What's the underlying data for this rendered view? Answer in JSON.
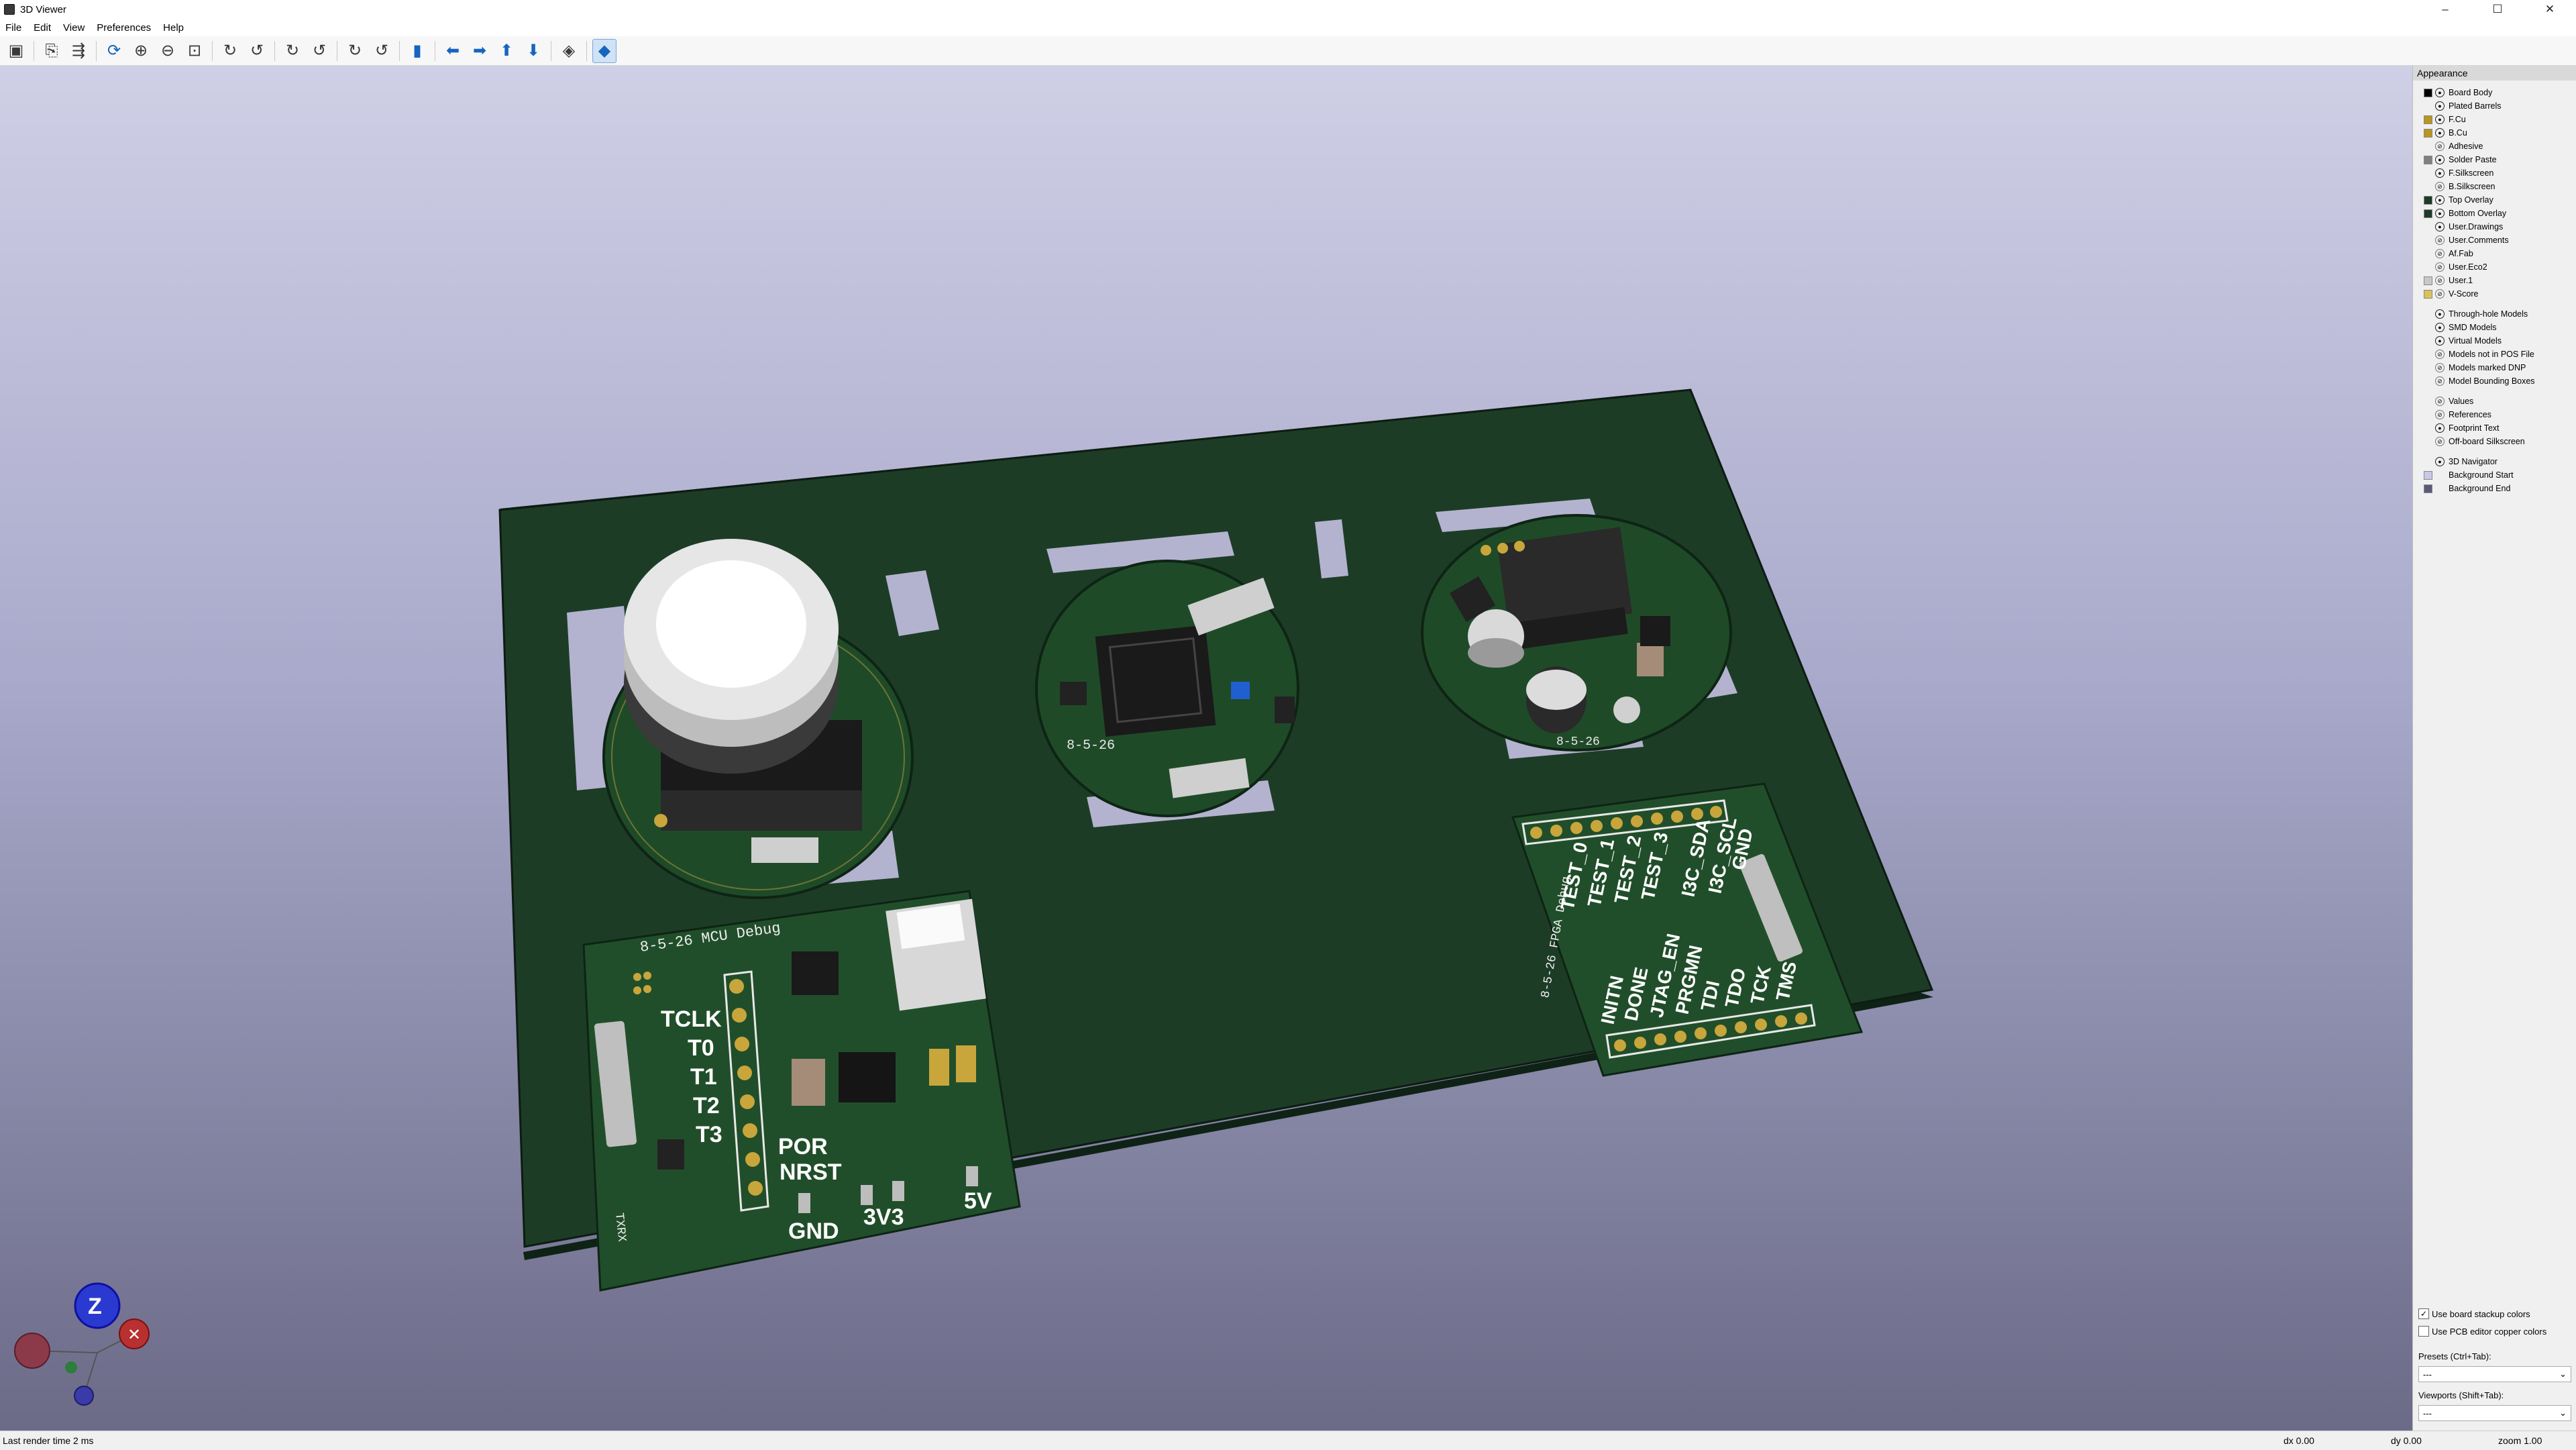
{
  "window": {
    "title": "3D Viewer",
    "controls": [
      "–",
      "☐",
      "✕"
    ]
  },
  "menu": [
    "File",
    "Edit",
    "View",
    "Preferences",
    "Help"
  ],
  "toolbar": {
    "tools": [
      {
        "name": "render-raytracing-button",
        "glyph": "▣"
      },
      {
        "name": "copy-image-button",
        "glyph": "⎘"
      },
      {
        "name": "export-image-button",
        "glyph": "⇶"
      },
      {
        "name": "reload-board-button",
        "glyph": "⟳"
      },
      {
        "name": "zoom-in-button",
        "glyph": "⊕"
      },
      {
        "name": "zoom-out-button",
        "glyph": "⊖"
      },
      {
        "name": "zoom-fit-button",
        "glyph": "⊡"
      },
      {
        "name": "rotate-x-cw-button",
        "glyph": "↻"
      },
      {
        "name": "rotate-x-ccw-button",
        "glyph": "↺"
      },
      {
        "name": "rotate-y-cw-button",
        "glyph": "↻"
      },
      {
        "name": "rotate-y-ccw-button",
        "glyph": "↺"
      },
      {
        "name": "rotate-z-cw-button",
        "glyph": "↻"
      },
      {
        "name": "rotate-z-ccw-button",
        "glyph": "↺"
      },
      {
        "name": "flip-board-button",
        "glyph": "▮"
      },
      {
        "name": "pan-left-button",
        "glyph": "⬅"
      },
      {
        "name": "pan-right-button",
        "glyph": "➡"
      },
      {
        "name": "pan-up-button",
        "glyph": "⬆"
      },
      {
        "name": "pan-down-button",
        "glyph": "⬇"
      },
      {
        "name": "toggle-orthographic-button",
        "glyph": "◈"
      },
      {
        "name": "toggle-layers-button",
        "glyph": "◆"
      }
    ]
  },
  "board": {
    "mcu_debug_title": "8-5-26 MCU Debug",
    "fpga_debug_title": "8-5-26 FPGA Debug",
    "mcu_labels": [
      "TCLK",
      "T0",
      "T1",
      "T2",
      "T3"
    ],
    "por_label": "POR",
    "nrst_label": "NRST",
    "gnd_label": "GND",
    "v33_label": "3V3",
    "v5_label": "5V",
    "txrx_label": "TXRX",
    "fpga_top_labels": [
      "TEST_0",
      "TEST_1",
      "TEST_2",
      "TEST_3",
      "I3C_SDA",
      "I3C_SCL",
      "GND"
    ],
    "fpga_bottom_labels": [
      "INITN",
      "DONE",
      "JTAG_EN",
      "PRGMN",
      "TDI",
      "TDO",
      "TCK",
      "TMS"
    ],
    "round_board_label": "8-5-26",
    "round_board_label_3": "8-5-26"
  },
  "navigator": {
    "z": "Z",
    "x_close": "✕"
  },
  "appearance": {
    "header": "Appearance",
    "layers": [
      {
        "label": "Board Body",
        "color": "#000000",
        "visible": true
      },
      {
        "label": "Plated Barrels",
        "color": "",
        "visible": true
      },
      {
        "label": "F.Cu",
        "color": "#b8961f",
        "visible": true
      },
      {
        "label": "B.Cu",
        "color": "#b8961f",
        "visible": true
      },
      {
        "label": "Adhesive",
        "color": "",
        "visible": false
      },
      {
        "label": "Solder Paste",
        "color": "#808080",
        "visible": true
      },
      {
        "label": "F.Silkscreen",
        "color": "",
        "visible": true
      },
      {
        "label": "B.Silkscreen",
        "color": "",
        "visible": false
      },
      {
        "label": "Top Overlay",
        "color": "#1e3a2a",
        "visible": true
      },
      {
        "label": "Bottom Overlay",
        "color": "#1e3a2a",
        "visible": true
      },
      {
        "label": "User.Drawings",
        "color": "",
        "visible": true
      },
      {
        "label": "User.Comments",
        "color": "",
        "visible": false
      },
      {
        "label": "Af.Fab",
        "color": "",
        "visible": false
      },
      {
        "label": "User.Eco2",
        "color": "",
        "visible": false
      },
      {
        "label": "User.1",
        "color": "#c8c8c8",
        "visible": false
      },
      {
        "label": "V-Score",
        "color": "#d8c35a",
        "visible": false
      }
    ],
    "models": [
      {
        "label": "Through-hole Models",
        "visible": true
      },
      {
        "label": "SMD Models",
        "visible": true
      },
      {
        "label": "Virtual Models",
        "visible": true
      },
      {
        "label": "Models not in POS File",
        "visible": false
      },
      {
        "label": "Models marked DNP",
        "visible": false
      },
      {
        "label": "Model Bounding Boxes",
        "visible": false
      }
    ],
    "texts": [
      {
        "label": "Values",
        "visible": false
      },
      {
        "label": "References",
        "visible": false
      },
      {
        "label": "Footprint Text",
        "visible": true
      },
      {
        "label": "Off-board Silkscreen",
        "visible": false
      }
    ],
    "misc": [
      {
        "label": "3D Navigator",
        "color": "",
        "visible": true
      },
      {
        "label": "Background Start",
        "color": "#c8c8e6",
        "visible": null
      },
      {
        "label": "Background End",
        "color": "#5a5a78",
        "visible": null
      }
    ],
    "use_stackup_colors": "Use board stackup colors",
    "use_pcb_copper_colors": "Use PCB editor copper colors",
    "presets_label": "Presets (Ctrl+Tab):",
    "presets_value": "---",
    "viewports_label": "Viewports (Shift+Tab):",
    "viewports_value": "---"
  },
  "status": {
    "render_time": "Last render time 2 ms",
    "dx": "dx 0.00",
    "dy": "dy 0.00",
    "zoom": "zoom 1.00"
  }
}
